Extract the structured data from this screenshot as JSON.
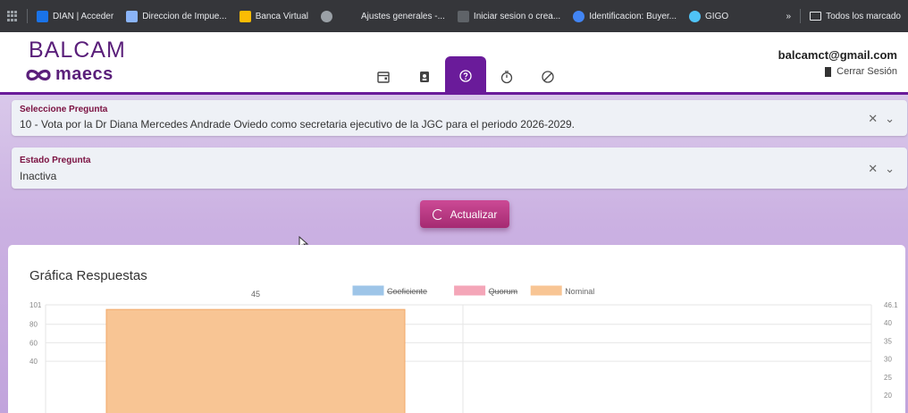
{
  "browser": {
    "bookmarks": [
      {
        "label": "DIAN | Acceder",
        "icon": "dian-icon",
        "color": "#1a73e8"
      },
      {
        "label": "Direccion de Impue...",
        "icon": "arrow-icon",
        "color": "#8ab4f8"
      },
      {
        "label": "Banca Virtual",
        "icon": "bank-icon",
        "color": "#fbbc04"
      },
      {
        "label": "",
        "icon": "globe-icon",
        "color": "#9aa0a6"
      },
      {
        "label": "Ajustes generales -...",
        "icon": "settings-icon",
        "color": "#35363a"
      },
      {
        "label": "Iniciar sesion o crea...",
        "icon": "login-icon",
        "color": "#5f6368"
      },
      {
        "label": "Identificacion: Buyer...",
        "icon": "id-icon",
        "color": "#4285f4"
      },
      {
        "label": "GIGO",
        "icon": "gigo-icon",
        "color": "#4fc3f7"
      }
    ],
    "overflow": "»",
    "all_bookmarks": "Todos los marcado"
  },
  "app": {
    "logo_top": "BALCAM",
    "logo_bottom": "maecs",
    "user_email": "balcamct@gmail.com",
    "logout_label": "Cerrar Sesión",
    "toolbar_icons": [
      "calendar-icon",
      "id-card-icon",
      "question-icon",
      "timer-icon",
      "disabled-icon"
    ],
    "active_tool": 2,
    "accent_color": "#6a1b9a"
  },
  "form": {
    "question_label": "Seleccione Pregunta",
    "question_value": "10 - Vota por la Dr Diana Mercedes Andrade Oviedo como secretaria ejecutivo de la JGC para el periodo 2026-2029.",
    "status_label": "Estado Pregunta",
    "status_value": "Inactiva",
    "clear_glyph": "✕",
    "open_glyph": "⌄",
    "update_button": "Actualizar"
  },
  "card": {
    "title": "Gráfica Respuestas"
  },
  "chart_data": {
    "type": "bar",
    "legend": [
      {
        "name": "Coeficiente",
        "color": "#9ec5e8",
        "hidden": true
      },
      {
        "name": "Quorum",
        "color": "#f4a6b8",
        "hidden": true
      },
      {
        "name": "Nominal",
        "color": "#f8c594",
        "hidden": false
      }
    ],
    "legend_position": "top-center",
    "bars": [
      {
        "series": "Nominal",
        "value": 96,
        "label": "45"
      }
    ],
    "y_left_ticks": [
      "101",
      "80",
      "60",
      "40"
    ],
    "y_left_range": [
      30,
      101
    ],
    "y_right_ticks": [
      "46.1",
      "40",
      "35",
      "30",
      "25",
      "20"
    ],
    "grid": true
  }
}
